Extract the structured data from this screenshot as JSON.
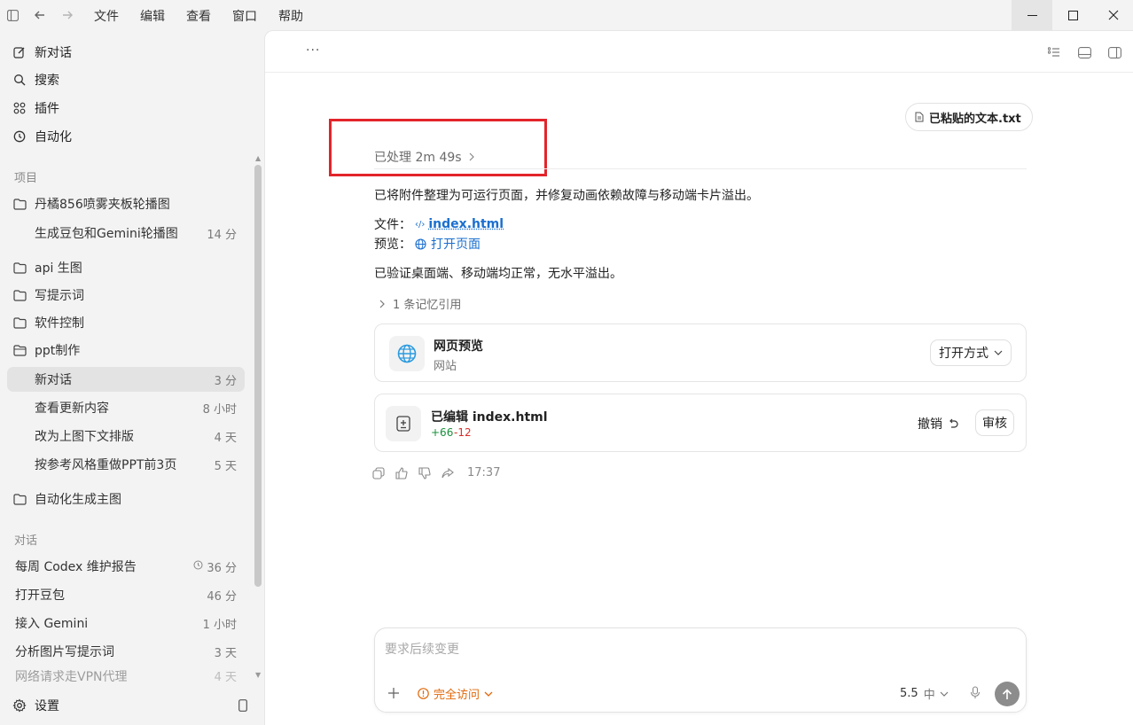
{
  "menubar": {
    "items": [
      "文件",
      "编辑",
      "查看",
      "窗口",
      "帮助"
    ]
  },
  "sidebar": {
    "nav": [
      {
        "label": "新对话",
        "icon": "edit-icon"
      },
      {
        "label": "搜索",
        "icon": "search-icon"
      },
      {
        "label": "插件",
        "icon": "plugins-icon"
      },
      {
        "label": "自动化",
        "icon": "clock-icon"
      }
    ],
    "projects_heading": "项目",
    "projects": [
      {
        "folder": "丹橘856喷雾夹板轮播图",
        "items": [
          {
            "label": "生成豆包和Gemini轮播图",
            "time": "14 分"
          }
        ]
      },
      {
        "folder": "api 生图",
        "items": []
      },
      {
        "folder": "写提示词",
        "items": []
      },
      {
        "folder": "软件控制",
        "items": []
      },
      {
        "folder": "ppt制作",
        "items": [
          {
            "label": "新对话",
            "time": "3 分",
            "active": true
          },
          {
            "label": "查看更新内容",
            "time": "8 小时"
          },
          {
            "label": "改为上图下文排版",
            "time": "4 天"
          },
          {
            "label": "按参考风格重做PPT前3页",
            "time": "5 天"
          }
        ]
      },
      {
        "folder": "自动化生成主图",
        "items": []
      }
    ],
    "conversations_heading": "对话",
    "conversations": [
      {
        "label": "每周 Codex 维护报告",
        "time": "36 分",
        "scheduled": true
      },
      {
        "label": "打开豆包",
        "time": "46 分"
      },
      {
        "label": "接入 Gemini",
        "time": "1 小时"
      },
      {
        "label": "分析图片写提示词",
        "time": "3 天"
      },
      {
        "label": "网络请求走VPN代理",
        "time": "4 天"
      }
    ],
    "settings_label": "设置"
  },
  "main": {
    "more_label": "···",
    "attachment_label": "已粘贴的文本.txt",
    "processed_label": "已处理 2m 49s",
    "summary": "已将附件整理为可运行页面，并修复动画依赖故障与移动端卡片溢出。",
    "file_label": "文件：",
    "file_link": "index.html",
    "preview_label": "预览：",
    "preview_link": "打开页面",
    "verify_text": "已验证桌面端、移动端均正常，无水平溢出。",
    "memory_label": "1 条记忆引用",
    "preview_card": {
      "title": "网页预览",
      "subtitle": "网站",
      "open_with": "打开方式"
    },
    "edit_card": {
      "title": "已编辑 index.html",
      "added": "+66",
      "removed": "-12",
      "undo": "撤销",
      "review": "审核"
    },
    "timestamp": "17:37",
    "composer": {
      "placeholder": "要求后续变更",
      "access": "完全访问",
      "model": "5.5",
      "effort": "中"
    }
  },
  "colors": {
    "accent": "#1a6fcf",
    "warning": "#e0680a",
    "added": "#1a8f3c",
    "removed": "#d9302b",
    "highlight_box": "#e3242b"
  }
}
